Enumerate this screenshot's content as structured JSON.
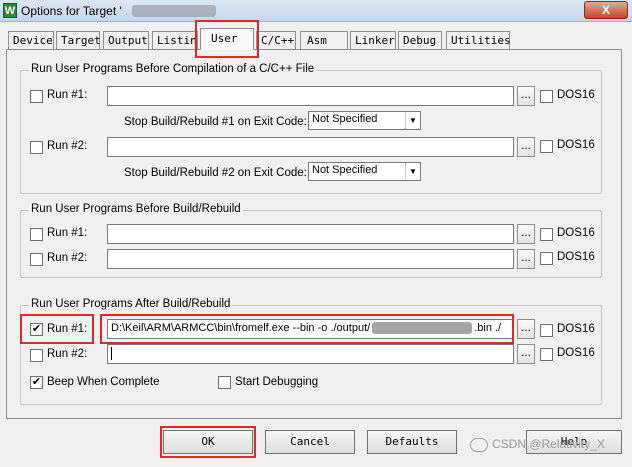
{
  "window": {
    "title": "Options for Target '",
    "close_label": "X"
  },
  "tabs": [
    {
      "label": "Device"
    },
    {
      "label": "Target"
    },
    {
      "label": "Output"
    },
    {
      "label": "Listing"
    },
    {
      "label": "User"
    },
    {
      "label": "C/C++"
    },
    {
      "label": "Asm"
    },
    {
      "label": "Linker"
    },
    {
      "label": "Debug"
    },
    {
      "label": "Utilities"
    }
  ],
  "active_tab": "User",
  "before_compile": {
    "title": "Run User Programs Before Compilation of a C/C++ File",
    "run1": {
      "label": "Run #1:",
      "checked": false,
      "value": "",
      "dos16": "DOS16",
      "stop_label": "Stop Build/Rebuild #1 on Exit Code:",
      "exit_code": "Not Specified"
    },
    "run2": {
      "label": "Run #2:",
      "checked": false,
      "value": "",
      "dos16": "DOS16",
      "stop_label": "Stop Build/Rebuild #2 on Exit Code:",
      "exit_code": "Not Specified"
    }
  },
  "before_build": {
    "title": "Run User Programs Before Build/Rebuild",
    "run1": {
      "label": "Run #1:",
      "checked": false,
      "value": "",
      "dos16": "DOS16"
    },
    "run2": {
      "label": "Run #2:",
      "checked": false,
      "value": "",
      "dos16": "DOS16"
    }
  },
  "after_build": {
    "title": "Run User Programs After Build/Rebuild",
    "run1": {
      "label": "Run #1:",
      "checked": true,
      "value_prefix": "D:\\Keil\\ARM\\ARMCC\\bin\\fromelf.exe --bin -o ./output/",
      "value_suffix": ".bin ./",
      "dos16": "DOS16"
    },
    "run2": {
      "label": "Run #2:",
      "checked": false,
      "value": "",
      "dos16": "DOS16"
    },
    "beep": {
      "label": "Beep When Complete",
      "checked": true
    },
    "start_debug": {
      "label": "Start Debugging",
      "checked": false
    }
  },
  "browse_label": "...",
  "checkmark": "✔",
  "buttons": {
    "ok": "OK",
    "cancel": "Cancel",
    "defaults": "Defaults",
    "help": "Help"
  },
  "watermark": "CSDN @Relativity_X"
}
